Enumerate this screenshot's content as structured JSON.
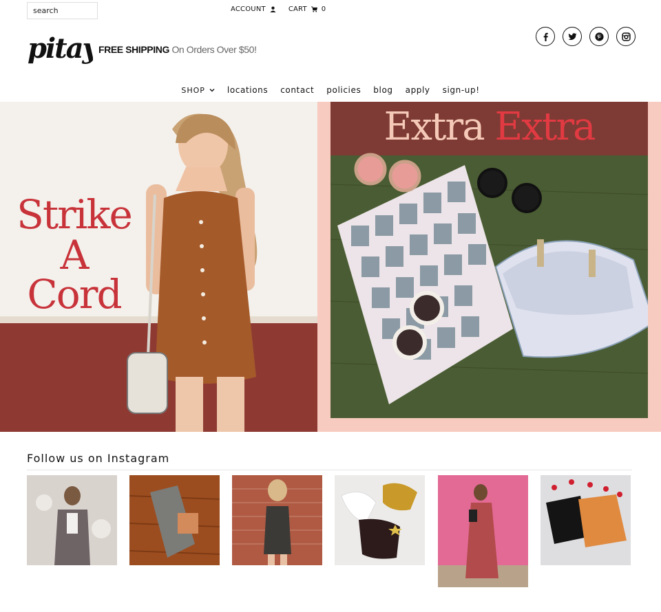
{
  "search": {
    "placeholder": "search"
  },
  "top_links": {
    "account": "ACCOUNT",
    "cart": "CART",
    "cart_count": "0"
  },
  "brand": {
    "logo_text": "pitaya"
  },
  "promo": {
    "bold": "FREE SHIPPING",
    "rest": "On Orders Over $50!"
  },
  "social": [
    "facebook-icon",
    "twitter-icon",
    "pinterest-icon",
    "instagram-icon"
  ],
  "nav": {
    "items": [
      "SHOP",
      "locations",
      "contact",
      "policies",
      "blog",
      "apply",
      "sign-up!"
    ]
  },
  "hero": {
    "left": {
      "line1": "Strike",
      "line2": "A",
      "line3": "Cord"
    },
    "right": {
      "word1": "Extra",
      "word2": "Extra"
    }
  },
  "instagram": {
    "title": "Follow us on Instagram",
    "tile_count": 6
  },
  "colors": {
    "accent_red": "#c8333a",
    "pink": "#f7cbc0",
    "green": "#4a5c33",
    "maroon": "#7e3a34"
  }
}
